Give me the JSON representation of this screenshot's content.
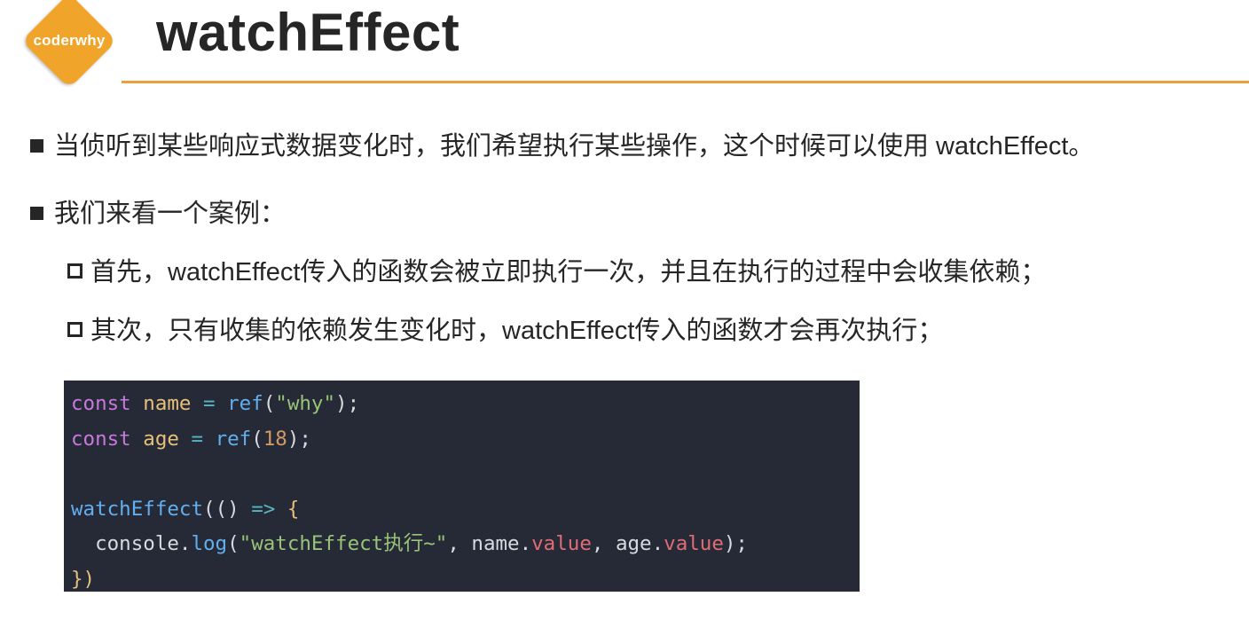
{
  "brand": {
    "logo_text": "coderwhy",
    "accent_color": "#f0a42a"
  },
  "title": "watchEffect",
  "bullets": [
    {
      "level": 1,
      "icon": "filled-square-bullet",
      "text": "当侦听到某些响应式数据变化时，我们希望执行某些操作，这个时候可以使用 watchEffect。"
    },
    {
      "level": 1,
      "icon": "filled-square-bullet",
      "text": "我们来看一个案例："
    },
    {
      "level": 2,
      "icon": "hollow-square-bullet",
      "text": "首先，watchEffect传入的函数会被立即执行一次，并且在执行的过程中会收集依赖；"
    },
    {
      "level": 2,
      "icon": "hollow-square-bullet",
      "text": "其次，只有收集的依赖发生变化时，watchEffect传入的函数才会再次执行；"
    }
  ],
  "code": {
    "background": "#262a36",
    "lines": [
      [
        "const",
        " ",
        "name",
        " ",
        "=",
        " ",
        "ref",
        "(",
        "\"why\"",
        ");"
      ],
      [
        "const",
        " ",
        "age",
        " ",
        "=",
        " ",
        "ref",
        "(",
        "18",
        ");"
      ],
      [],
      [
        "watchEffect",
        "(",
        "()",
        " ",
        "=>",
        " ",
        "{"
      ],
      [
        "  console.",
        "log",
        "(",
        "\"watchEffect执行~\"",
        ", name.",
        "value",
        ", age.",
        "value",
        ");"
      ],
      [
        "})"
      ]
    ]
  }
}
